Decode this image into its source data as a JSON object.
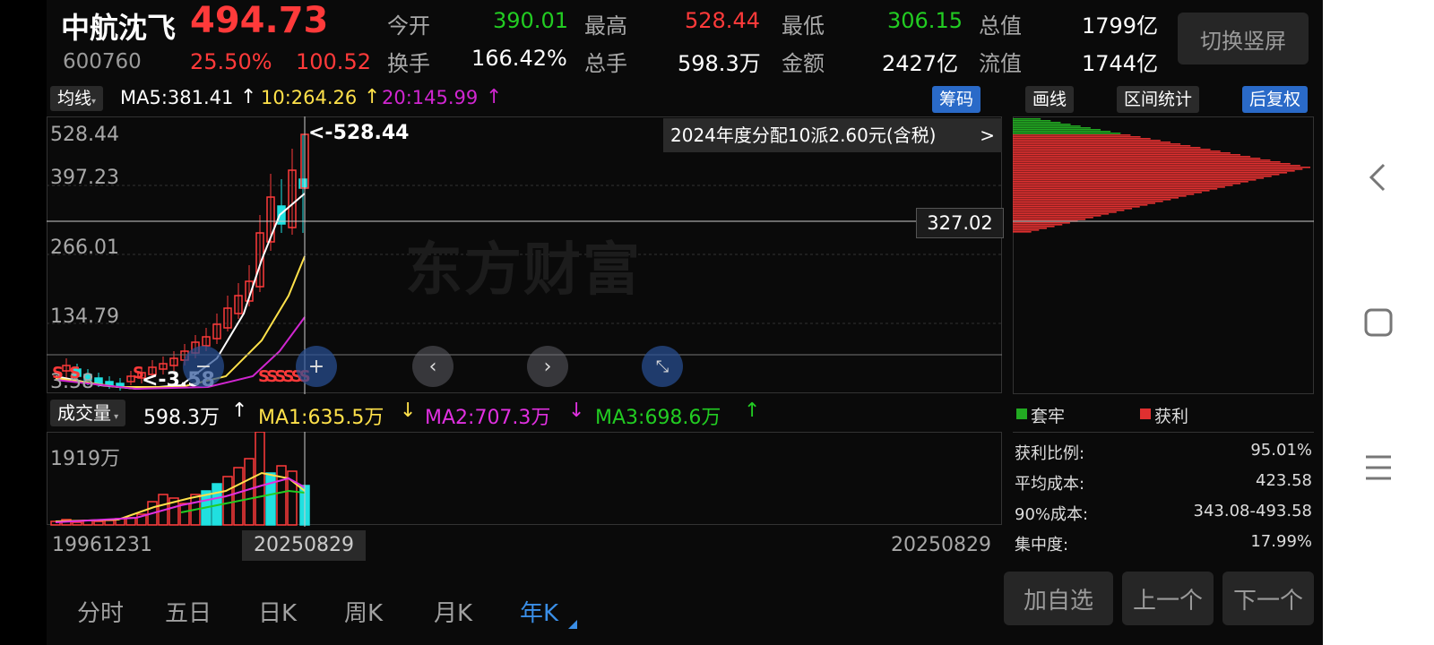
{
  "stock": {
    "name": "中航沈飞",
    "code": "600760",
    "price": "494.73",
    "change_pct": "25.50%",
    "change": "100.52"
  },
  "quote": {
    "open_label": "今开",
    "open": "390.01",
    "high_label": "最高",
    "high": "528.44",
    "low_label": "最低",
    "low": "306.15",
    "total_cap_label": "总值",
    "total_cap": "1799亿",
    "turnover_label": "换手",
    "turnover": "166.42%",
    "volume_label": "总手",
    "volume": "598.3万",
    "amount_label": "金额",
    "amount": "2427亿",
    "float_cap_label": "流值",
    "float_cap": "1744亿"
  },
  "switch_button": "切换竖屏",
  "ma_bar": {
    "selector": "均线",
    "ma5": "MA5:381.41",
    "ma10": "10:264.26",
    "ma20": "20:145.99",
    "arrow_up": "↑",
    "chip_tab": "筹码"
  },
  "right_tools": {
    "draw": "画线",
    "range": "区间统计",
    "adjust": "后复权"
  },
  "price_axis": [
    "528.44",
    "397.23",
    "266.01",
    "134.79",
    "3.58"
  ],
  "max_marker": "<-528.44",
  "min_marker": "<-3.58",
  "dividend_notice": "2024年度分配10派2.60元(含税)",
  "dividend_chevron": ">",
  "crosshair_price": "327.02",
  "watermark": "东方财富",
  "sell_markers": "SSSSSS",
  "sell_left": "S S",
  "sell_mid": "S",
  "volume_bar": {
    "selector": "成交量",
    "value": "598.3万",
    "ma1": "MA1:635.5万",
    "ma2": "MA2:707.3万",
    "ma3": "MA3:698.6万",
    "arrow_up": "↑",
    "arrow_down": "↓"
  },
  "volume_axis_max": "1919万",
  "dates": {
    "start": "19961231",
    "cursor": "20250829",
    "end": "20250829"
  },
  "chip_legend": {
    "trapped": "套牢",
    "profit": "获利"
  },
  "chip_stats": [
    {
      "label": "获利比例:",
      "value": "95.01%"
    },
    {
      "label": "平均成本:",
      "value": "423.58"
    },
    {
      "label": "90%成本:",
      "value": "343.08-493.58"
    },
    {
      "label": "集中度:",
      "value": "17.99%"
    }
  ],
  "period_tabs": [
    "分时",
    "五日",
    "日K",
    "周K",
    "月K",
    "年K"
  ],
  "actions": {
    "add_watch": "加自选",
    "prev": "上一个",
    "next": "下一个"
  },
  "colors": {
    "up": "#ff3a3a",
    "down": "#22cc22",
    "accent": "#2a6ac8",
    "ma5": "#ffffff",
    "ma10": "#ffe14a",
    "ma20": "#d026d0"
  },
  "icons": {
    "back": "chevron-left-icon",
    "home": "square-icon",
    "menu": "menu-icon"
  }
}
